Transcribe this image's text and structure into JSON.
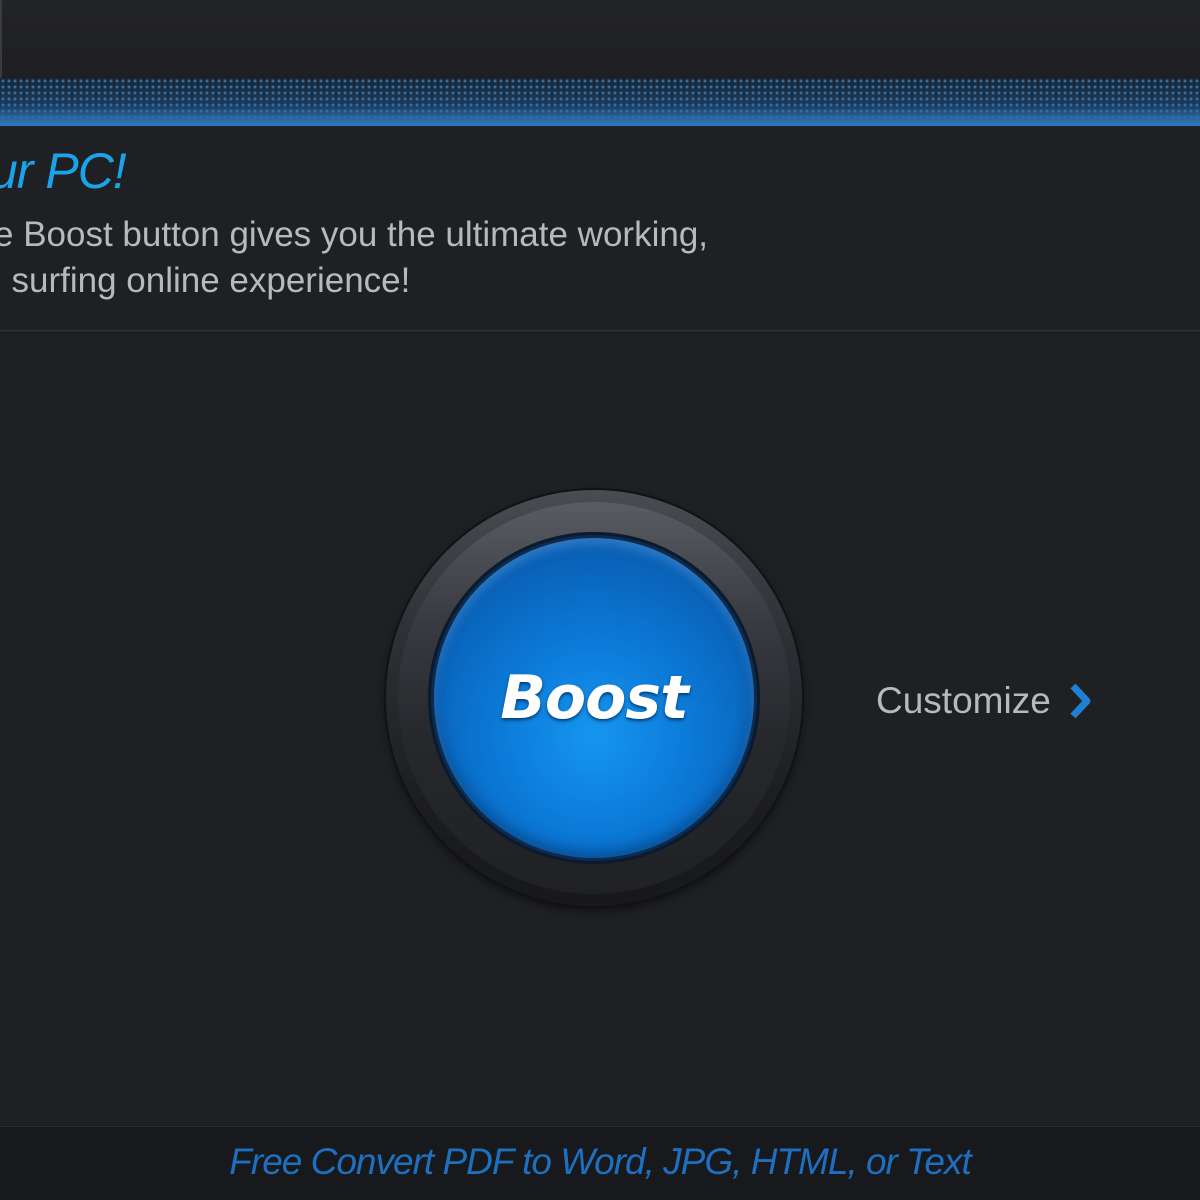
{
  "header": {
    "headline": "ur PC!",
    "description_line1": "e Boost button gives you the ultimate working,",
    "description_line2": "l surfing online experience!"
  },
  "boost": {
    "button_label": "Boost"
  },
  "customize": {
    "label": "Customize",
    "icon": "chevron-right-icon"
  },
  "footer": {
    "link_text": "Free Convert PDF to Word, JPG, HTML, or Text"
  },
  "colors": {
    "background": "#1f2023",
    "accent": "#1aa3e8",
    "button_blue": "#0b78d6",
    "footer_link": "#1e6fbf",
    "body_text": "#b7b9bd"
  }
}
